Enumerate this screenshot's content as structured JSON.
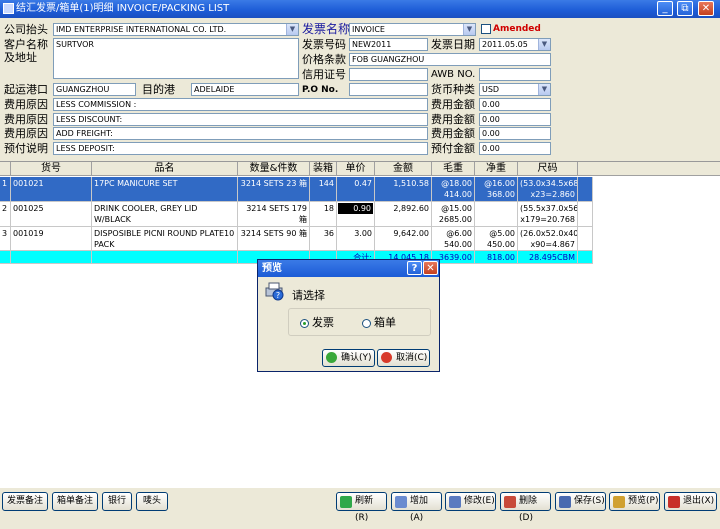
{
  "window": {
    "title": "结汇发票/箱单(1)明细 INVOICE/PACKING LIST",
    "buttons": [
      "_",
      "⧉",
      "✕"
    ]
  },
  "form": {
    "company_label": "公司抬头",
    "company_value": "IMD ENTERPRISE INTERNATIONAL CO. LTD.",
    "invoice_name_label": "发票名称",
    "invoice_name_value": "INVOICE",
    "amended_label": "Amended",
    "customer_label_1": "客户名称",
    "customer_label_2": "及地址",
    "customer_value": "SURTVOR",
    "invoice_no_label": "发票号码",
    "invoice_no_value": "NEW2011",
    "invoice_date_label": "发票日期",
    "invoice_date_value": "2011.05.05",
    "price_terms_label": "价格条款",
    "price_terms_value": "FOB GUANGZHOU",
    "credit_label": "信用证号",
    "credit_value": "",
    "awb_label": "AWB NO.",
    "awb_value": "",
    "origin_label": "起运港口",
    "origin_value": "GUANGZHOU",
    "dest_label": "目的港",
    "dest_value": "ADELAIDE",
    "po_label": "P.O No.",
    "po_value": "",
    "currency_label": "货币种类",
    "currency_value": "USD",
    "fees": [
      {
        "label": "费用原因",
        "value": "LESS COMMISSION :",
        "amount_label": "费用金额",
        "amount": "0.00"
      },
      {
        "label": "费用原因",
        "value": "LESS DISCOUNT:",
        "amount_label": "费用金额",
        "amount": "0.00"
      },
      {
        "label": "费用原因",
        "value": "ADD FREIGHT:",
        "amount_label": "费用金额",
        "amount": "0.00"
      },
      {
        "label": "预付说明",
        "value": "LESS DEPOSIT:",
        "amount_label": "预付金额",
        "amount": "0.00"
      }
    ]
  },
  "grid": {
    "headers": [
      "货号",
      "品名",
      "数量&件数",
      "装箱",
      "单价",
      "金额",
      "毛重",
      "净重",
      "尺码"
    ],
    "rows": [
      {
        "num": "1",
        "code": "001021",
        "name": "17PC MANICURE SET",
        "qty": "3214 SETS 23 箱",
        "box": "144",
        "price": "0.47",
        "amount": "1,510.58",
        "gross": "@18.00 414.00",
        "net": "@16.00 368.00",
        "size": "(53.0x34.5x68. x23=2.860"
      },
      {
        "num": "2",
        "code": "001025",
        "name": "DRINK COOLER, GREY LID W/BLACK",
        "qty": "3214 SETS 179 箱",
        "box": "18",
        "price": "0.90",
        "amount": "2,892.60",
        "gross": "@15.00 2685.00",
        "net": "",
        "size": "(55.5x37.0x56. x179=20.768"
      },
      {
        "num": "3",
        "code": "001019",
        "name": "DISPOSIBLE PICNI ROUND PLATE10 PACK",
        "qty": "3214 SETS 90 箱",
        "box": "36",
        "price": "3.00",
        "amount": "9,642.00",
        "gross": "@6.00 540.00",
        "net": "@5.00 450.00",
        "size": "(26.0x52.0x40. x90=4.867"
      }
    ],
    "total": {
      "label": "合计:",
      "amount": "14,045.18",
      "gross": "3639.00",
      "net": "818.00",
      "size": "28.495CBM"
    }
  },
  "dialog": {
    "title": "预览",
    "prompt": "请选择",
    "option_invoice": "发票",
    "option_packing": "箱单",
    "selected": "发票",
    "ok_label": "确认(Y)",
    "cancel_label": "取消(C)"
  },
  "bottom_left": [
    "发票备注",
    "箱单备注",
    "银行",
    "唛头"
  ],
  "bottom_right": [
    "刷新(R)",
    "增加(A)",
    "修改(E)",
    "删除(D)",
    "保存(S)",
    "预览(P)",
    "退出(X)"
  ],
  "colors": {
    "selection": "#316ac5",
    "total_row": "#00ffff",
    "titlebar": "#1c5bd6",
    "amended": "#d00000"
  }
}
